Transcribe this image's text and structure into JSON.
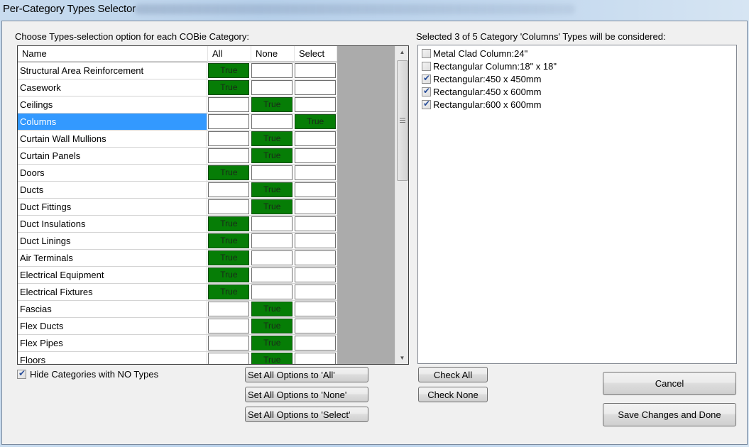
{
  "window": {
    "title": "Per-Category Types Selector"
  },
  "left_panel": {
    "heading": "Choose Types-selection option for each COBie Category:",
    "columns": [
      "Name",
      "All",
      "None",
      "Select"
    ],
    "true_label": "True",
    "selected_row": "Columns",
    "rows": [
      {
        "name": "Structural Area Reinforcement",
        "all": "True",
        "none": "",
        "select": ""
      },
      {
        "name": "Casework",
        "all": "True",
        "none": "",
        "select": ""
      },
      {
        "name": "Ceilings",
        "all": "",
        "none": "True",
        "select": ""
      },
      {
        "name": "Columns",
        "all": "",
        "none": "",
        "select": "True"
      },
      {
        "name": "Curtain Wall Mullions",
        "all": "",
        "none": "True",
        "select": ""
      },
      {
        "name": "Curtain Panels",
        "all": "",
        "none": "True",
        "select": ""
      },
      {
        "name": "Doors",
        "all": "True",
        "none": "",
        "select": ""
      },
      {
        "name": "Ducts",
        "all": "",
        "none": "True",
        "select": ""
      },
      {
        "name": "Duct Fittings",
        "all": "",
        "none": "True",
        "select": ""
      },
      {
        "name": "Duct Insulations",
        "all": "True",
        "none": "",
        "select": ""
      },
      {
        "name": "Duct Linings",
        "all": "True",
        "none": "",
        "select": ""
      },
      {
        "name": "Air Terminals",
        "all": "True",
        "none": "",
        "select": ""
      },
      {
        "name": "Electrical Equipment",
        "all": "True",
        "none": "",
        "select": ""
      },
      {
        "name": "Electrical Fixtures",
        "all": "True",
        "none": "",
        "select": ""
      },
      {
        "name": "Fascias",
        "all": "",
        "none": "True",
        "select": ""
      },
      {
        "name": "Flex Ducts",
        "all": "",
        "none": "True",
        "select": ""
      },
      {
        "name": "Flex Pipes",
        "all": "",
        "none": "True",
        "select": ""
      },
      {
        "name": "Floors",
        "all": "",
        "none": "True",
        "select": ""
      }
    ],
    "hide_categories": {
      "label": "Hide Categories with NO Types",
      "checked": true
    },
    "buttons": {
      "set_all": "Set All Options to 'All'",
      "set_none": "Set All Options to 'None'",
      "set_select": "Set All Options to 'Select'"
    }
  },
  "right_panel": {
    "heading": "Selected 3 of 5 Category 'Columns' Types will be considered:",
    "types": [
      {
        "label": "Metal Clad Column:24\"",
        "checked": false
      },
      {
        "label": "Rectangular Column:18\" x 18\"",
        "checked": false
      },
      {
        "label": "Rectangular:450 x 450mm",
        "checked": true
      },
      {
        "label": "Rectangular:450 x 600mm",
        "checked": true
      },
      {
        "label": "Rectangular:600 x 600mm",
        "checked": true
      }
    ],
    "buttons": {
      "check_all": "Check All",
      "check_none": "Check None",
      "cancel": "Cancel",
      "save": "Save Changes and Done"
    }
  },
  "colors": {
    "true_cell": "#067d06",
    "selected_row": "#3399ff",
    "grid_background": "#ababab"
  }
}
